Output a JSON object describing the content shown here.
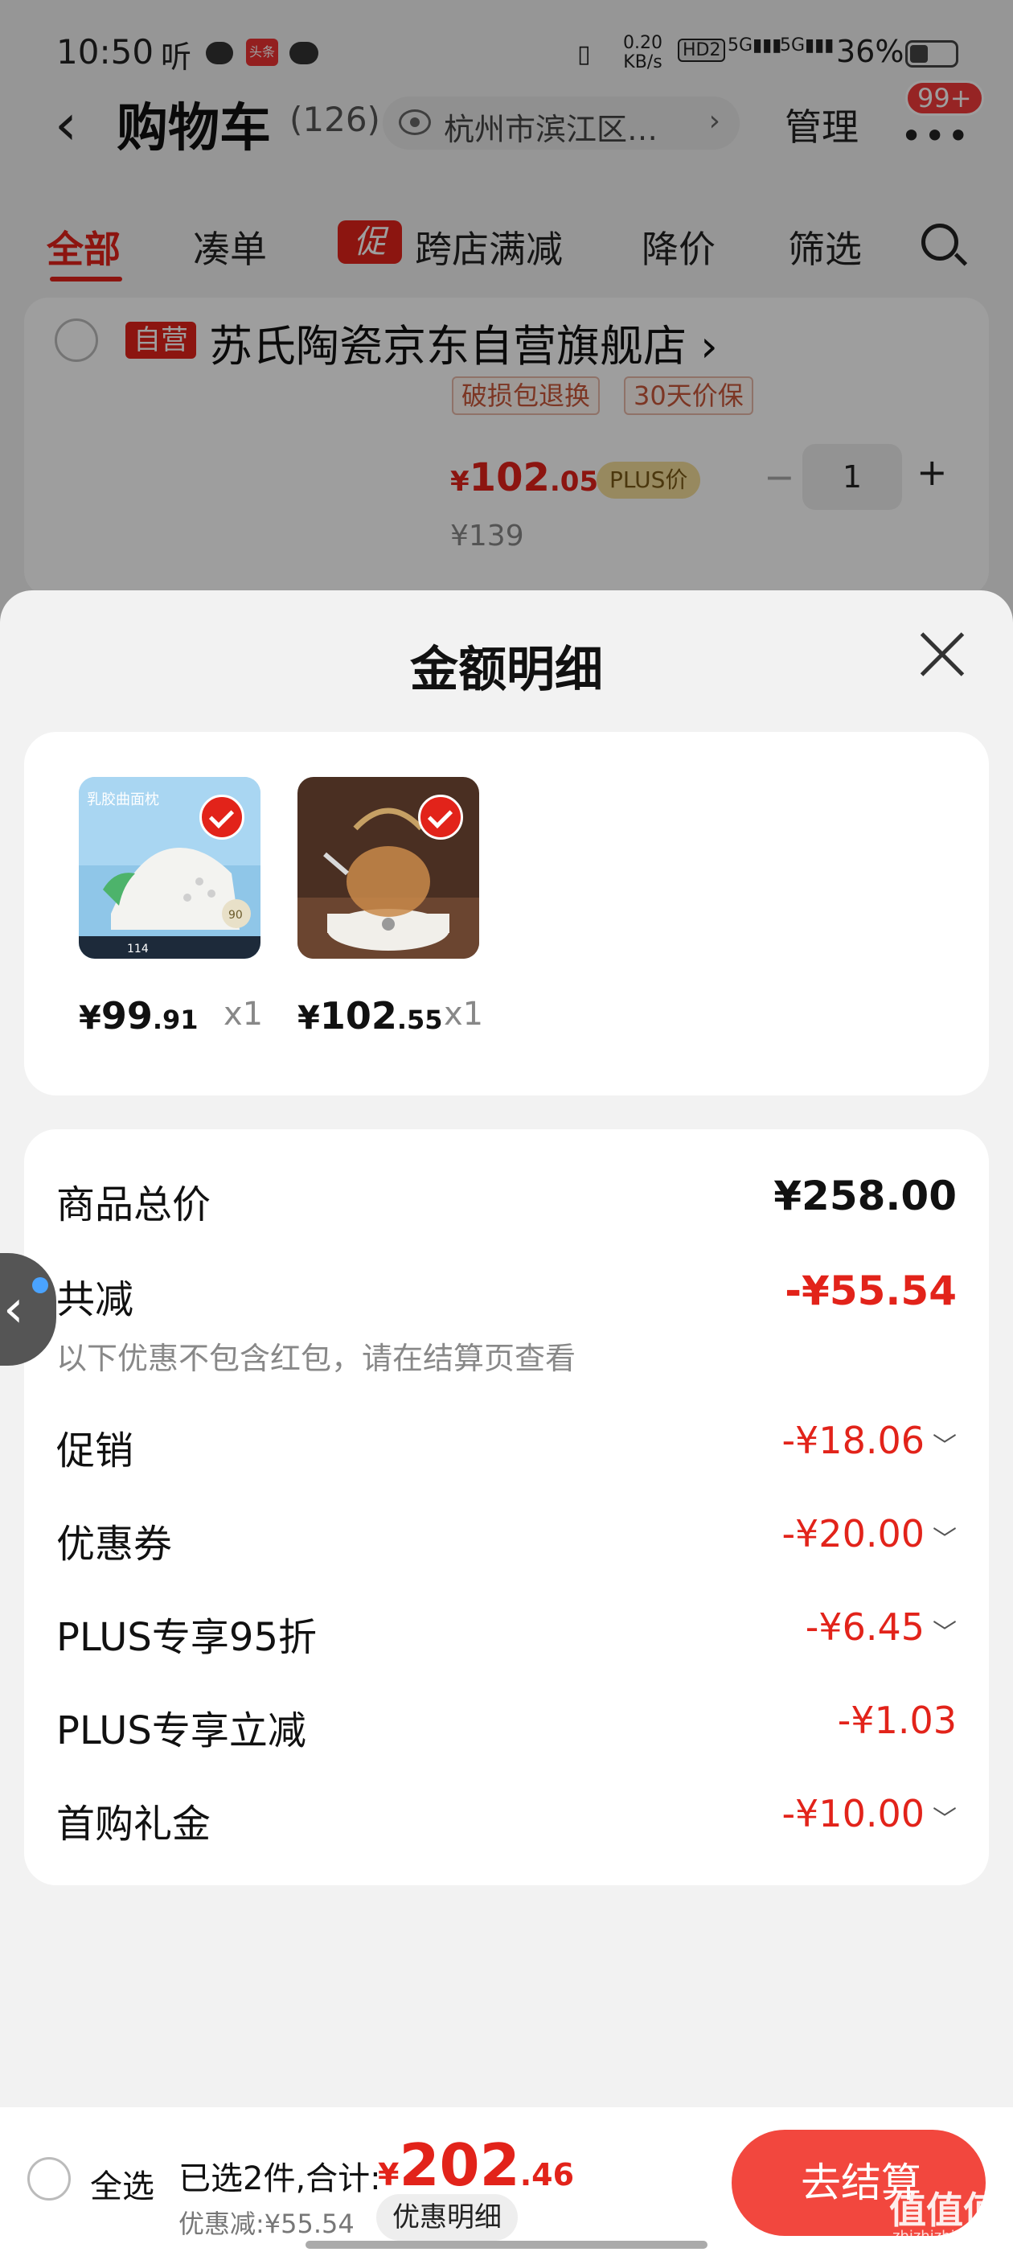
{
  "status": {
    "time": "10:50",
    "ting": "听",
    "toutiao": "头条",
    "speed_top": "0.20",
    "speed_bottom": "KB/s",
    "hd": "HD2",
    "sig1": "5G",
    "sig2": "5G",
    "battery": "36%"
  },
  "header": {
    "title": "购物车",
    "count": "(126)",
    "location": "杭州市滨江区…",
    "manage": "管理",
    "more": "•••",
    "badge": "99+"
  },
  "tabs": [
    {
      "label": "全部"
    },
    {
      "label": "凑单"
    },
    {
      "label": "跨店满减",
      "icon": "促"
    },
    {
      "label": "降价"
    },
    {
      "label": "筛选"
    }
  ],
  "store": {
    "badge": "自营",
    "name": "苏氏陶瓷京东自营旗舰店",
    "chevron": "›",
    "tags": [
      "破损包退换",
      "30天价保"
    ],
    "price_symbol": "¥",
    "price_int": "102",
    "price_dec": ".05",
    "plus_label": "PLUS价",
    "original_price": "¥139",
    "quantity": "1",
    "minus": "−",
    "plus": "+"
  },
  "sheet": {
    "title": "金额明细",
    "items": [
      {
        "image": "latex-pillow-product-image",
        "sym": "¥",
        "int": "99",
        "dec": ".91",
        "qty": "x1"
      },
      {
        "image": "glass-teapot-product-image",
        "sym": "¥",
        "int": "102",
        "dec": ".55",
        "qty": "x1"
      }
    ],
    "thumb1_texts": {
      "t1": "乳胶曲面枕",
      "t2": "90",
      "t3": "114"
    },
    "details": {
      "total_label": "商品总价",
      "total_value": "¥258.00",
      "reduce_label": "共减",
      "reduce_value": "-¥55.54",
      "note": "以下优惠不包含红包，请在结算页查看",
      "rows": [
        {
          "label": "促销",
          "value": "-¥18.06",
          "chevron": "﹀"
        },
        {
          "label": "优惠券",
          "value": "-¥20.00",
          "chevron": "﹀"
        },
        {
          "label": "PLUS专享95折",
          "value": "-¥6.45",
          "chevron": "﹀"
        },
        {
          "label": "PLUS专享立减",
          "value": "-¥1.03",
          "chevron": ""
        },
        {
          "label": "首购礼金",
          "value": "-¥10.00",
          "chevron": "﹀"
        }
      ]
    }
  },
  "bottom": {
    "select_all": "全选",
    "selected_text": "已选2件,合计:",
    "total_sym": "¥",
    "total_int": "202",
    "total_dec": ".46",
    "saved": "优惠减:¥55.54",
    "detail_button": "优惠明细",
    "checkout": "去结算"
  },
  "watermark": {
    "main": "值值值",
    "sub": "zhizhizhi.com"
  },
  "colors": {
    "accent": "#e2231a",
    "checkout": "#f2473e",
    "plus_tag": "#f4dd9a"
  }
}
